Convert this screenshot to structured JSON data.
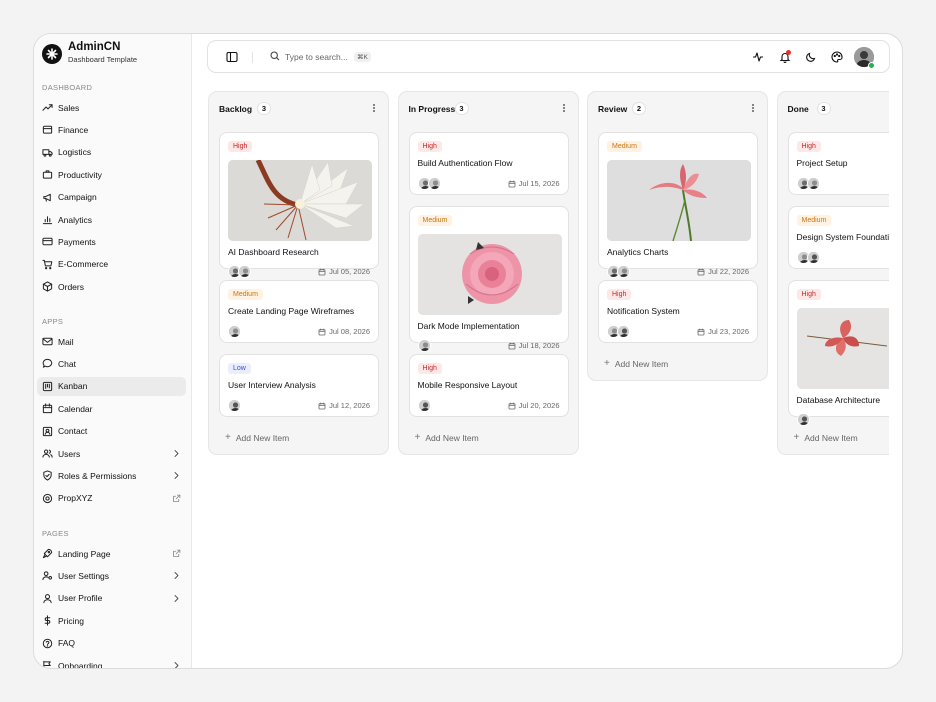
{
  "brand": {
    "name": "AdminCN",
    "subtitle": "Dashboard Template"
  },
  "sidebar": {
    "sections": [
      {
        "label": "DASHBOARD",
        "items": [
          {
            "label": "Sales",
            "icon": "trending-up-icon"
          },
          {
            "label": "Finance",
            "icon": "wallet-icon"
          },
          {
            "label": "Logistics",
            "icon": "truck-icon"
          },
          {
            "label": "Productivity",
            "icon": "briefcase-icon"
          },
          {
            "label": "Campaign",
            "icon": "megaphone-icon"
          },
          {
            "label": "Analytics",
            "icon": "bar-chart-icon"
          },
          {
            "label": "Payments",
            "icon": "credit-card-icon"
          },
          {
            "label": "E-Commerce",
            "icon": "shopping-cart-icon"
          },
          {
            "label": "Orders",
            "icon": "package-icon"
          }
        ]
      },
      {
        "label": "APPS",
        "items": [
          {
            "label": "Mail",
            "icon": "mail-icon"
          },
          {
            "label": "Chat",
            "icon": "chat-icon"
          },
          {
            "label": "Kanban",
            "icon": "kanban-icon",
            "active": true
          },
          {
            "label": "Calendar",
            "icon": "calendar-icon"
          },
          {
            "label": "Contact",
            "icon": "contact-icon"
          },
          {
            "label": "Users",
            "icon": "users-icon",
            "right": "chevron-right-icon"
          },
          {
            "label": "Roles & Permissions",
            "icon": "shield-icon",
            "right": "chevron-right-icon"
          },
          {
            "label": "PropXYZ",
            "icon": "globe-icon",
            "right": "external-link-icon"
          }
        ]
      },
      {
        "label": "PAGES",
        "items": [
          {
            "label": "Landing Page",
            "icon": "rocket-icon",
            "right": "external-link-icon"
          },
          {
            "label": "User Settings",
            "icon": "user-cog-icon",
            "right": "chevron-right-icon"
          },
          {
            "label": "User Profile",
            "icon": "user-icon",
            "right": "chevron-right-icon"
          },
          {
            "label": "Pricing",
            "icon": "dollar-icon"
          },
          {
            "label": "FAQ",
            "icon": "help-circle-icon"
          },
          {
            "label": "Onboarding",
            "icon": "onboarding-icon",
            "right": "chevron-right-icon"
          }
        ]
      }
    ]
  },
  "topbar": {
    "search_placeholder": "Type to search...",
    "search_shortcut": "⌘K",
    "icons": [
      "sidebar-toggle-icon",
      "search-icon",
      "activity-icon",
      "bell-icon",
      "moon-icon",
      "palette-icon"
    ]
  },
  "board": {
    "add_label": "Add New Item",
    "columns": [
      {
        "title": "Backlog",
        "count": "3",
        "cards": [
          {
            "priority": "High",
            "level": "high",
            "title": "AI Dashboard Research",
            "date": "Jul 05, 2026",
            "image": "white-cactus-flower",
            "avatars": 2
          },
          {
            "priority": "Medium",
            "level": "medium",
            "title": "Create Landing Page Wireframes",
            "date": "Jul 08, 2026",
            "avatars": 1
          },
          {
            "priority": "Low",
            "level": "low",
            "title": "User Interview Analysis",
            "date": "Jul 12, 2026",
            "avatars": 1
          }
        ]
      },
      {
        "title": "In Progress",
        "count": "3",
        "cards": [
          {
            "priority": "High",
            "level": "high",
            "title": "Build Authentication Flow",
            "date": "Jul 15, 2026",
            "avatars": 2
          },
          {
            "priority": "Medium",
            "level": "medium",
            "title": "Dark Mode Implementation",
            "date": "Jul 18, 2026",
            "image": "pink-rose",
            "avatars": 1
          },
          {
            "priority": "High",
            "level": "high",
            "title": "Mobile Responsive Layout",
            "date": "Jul 20, 2026",
            "avatars": 1
          }
        ]
      },
      {
        "title": "Review",
        "count": "2",
        "cards": [
          {
            "priority": "Medium",
            "level": "medium",
            "title": "Analytics Charts",
            "date": "Jul 22, 2026",
            "image": "pink-iris",
            "avatars": 2
          },
          {
            "priority": "High",
            "level": "high",
            "title": "Notification System",
            "date": "Jul 23, 2026",
            "avatars": 2
          }
        ]
      },
      {
        "title": "Done",
        "count": "3",
        "cards": [
          {
            "priority": "High",
            "level": "high",
            "title": "Project Setup",
            "date": "",
            "avatars": 2
          },
          {
            "priority": "Medium",
            "level": "medium",
            "title": "Design System Foundations",
            "date": "",
            "avatars": 2
          },
          {
            "priority": "High",
            "level": "high",
            "title": "Database Architecture",
            "date": "",
            "image": "red-hibiscus",
            "avatars": 1
          }
        ]
      }
    ]
  }
}
